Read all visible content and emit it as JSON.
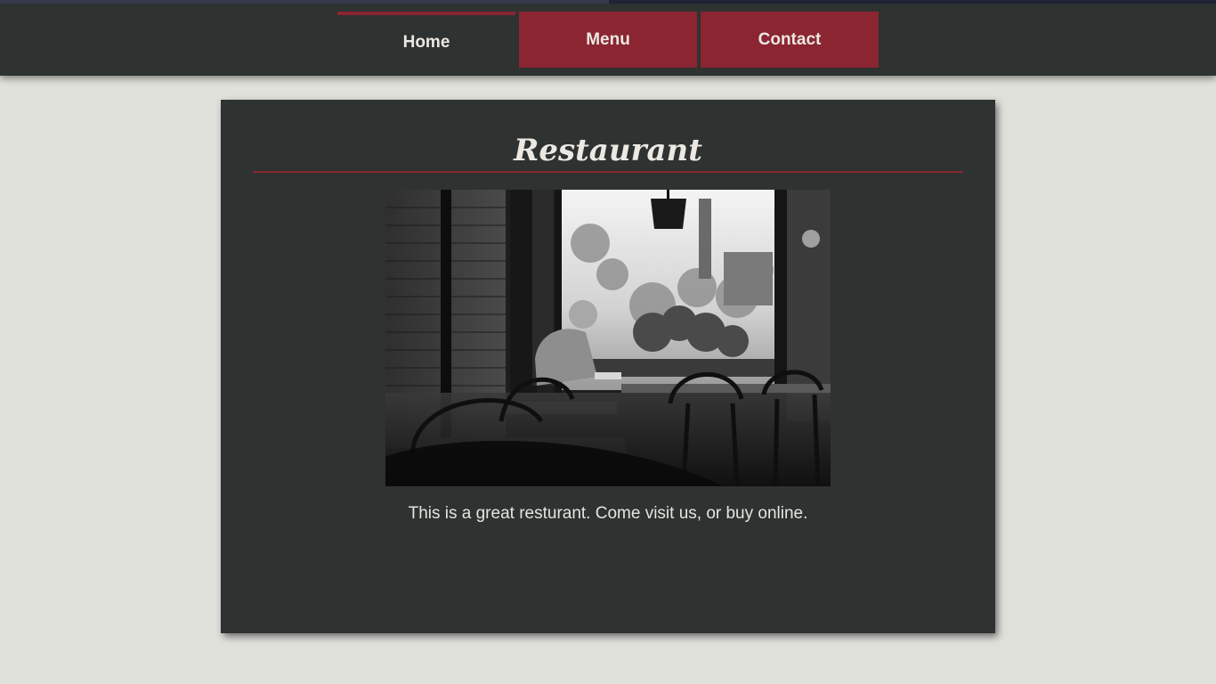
{
  "nav": {
    "items": [
      {
        "label": "Home",
        "active": true
      },
      {
        "label": "Menu",
        "active": false
      },
      {
        "label": "Contact",
        "active": false
      }
    ]
  },
  "main": {
    "title": "Restaurant",
    "image_subject": "black-and-white photo of a man reading at a cafe table by a window",
    "caption": "This is a great resturant. Come visit us, or buy online."
  },
  "colors": {
    "page_bg": "#e1e1dc",
    "navbar_bg": "#2e3230",
    "accent": "#8b2532",
    "card_bg": "#2e3230",
    "text": "#ece8e2"
  }
}
